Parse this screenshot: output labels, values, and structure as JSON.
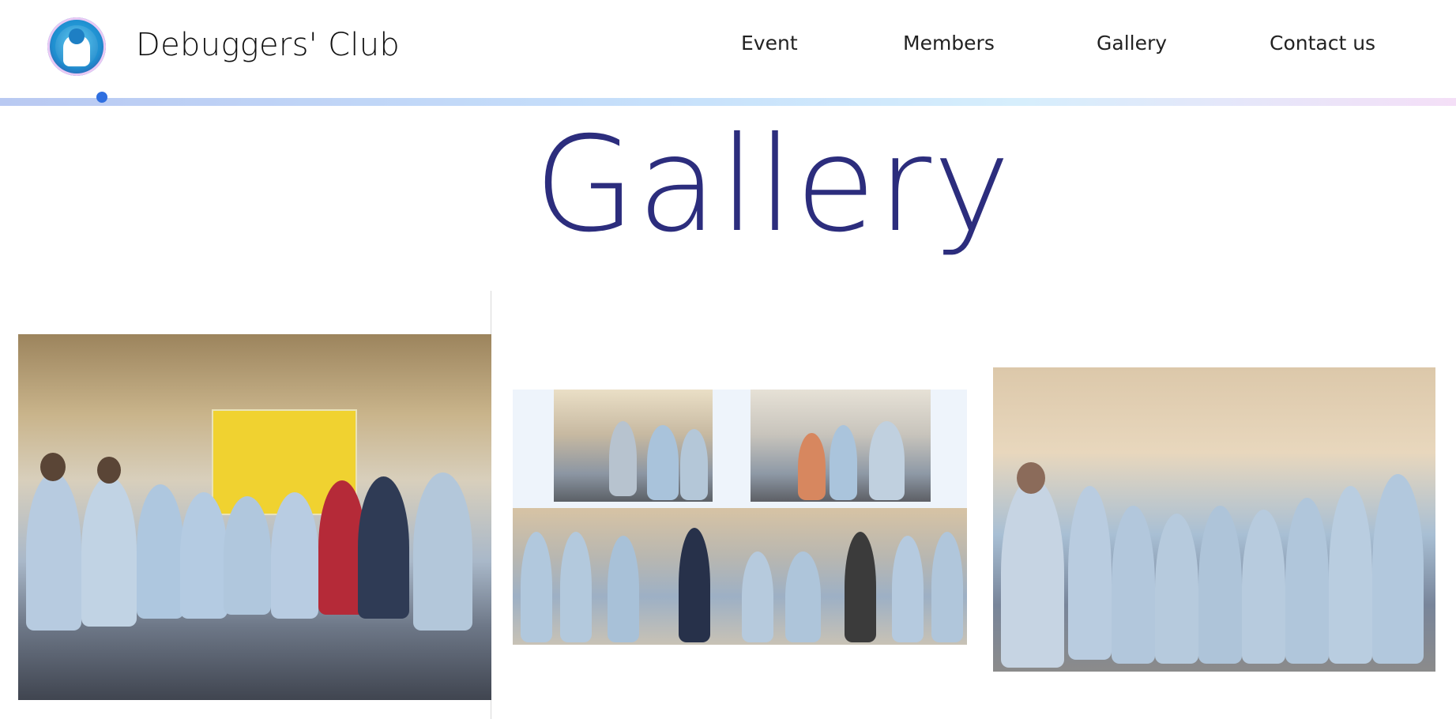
{
  "brand": {
    "name": "Debuggers' Club"
  },
  "nav": {
    "items": [
      "Event",
      "Members",
      "Gallery",
      "Contact us"
    ]
  },
  "page": {
    "title": "Gallery"
  },
  "gallery": {
    "images": [
      "group-photo-left",
      "collage-center",
      "group-photo-right"
    ]
  }
}
